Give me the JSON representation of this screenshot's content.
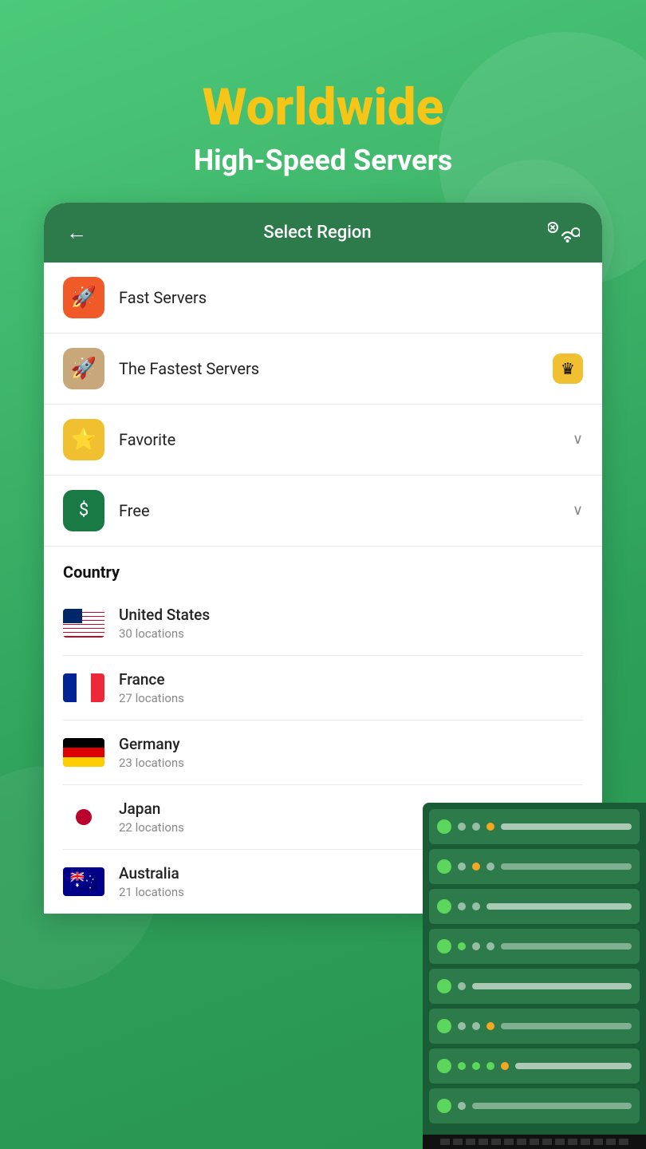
{
  "hero": {
    "title": "Worldwide",
    "subtitle": "High-Speed Servers"
  },
  "header": {
    "back_label": "←",
    "title": "Select Region"
  },
  "menu_items": [
    {
      "id": "fast-servers",
      "label": "Fast Servers",
      "icon_type": "orange",
      "icon": "🚀",
      "has_chevron": false,
      "has_crown": false
    },
    {
      "id": "fastest-servers",
      "label": "The Fastest Servers",
      "icon_type": "tan",
      "icon": "🚀",
      "has_chevron": false,
      "has_crown": true
    },
    {
      "id": "favorite",
      "label": "Favorite",
      "icon_type": "yellow",
      "icon": "⭐",
      "has_chevron": true,
      "has_crown": false
    },
    {
      "id": "free",
      "label": "Free",
      "icon_type": "green",
      "icon": "💲",
      "has_chevron": true,
      "has_crown": false
    }
  ],
  "country_section": {
    "header": "Country",
    "countries": [
      {
        "id": "us",
        "name": "United States",
        "locations": "30 locations",
        "flag": "us"
      },
      {
        "id": "fr",
        "name": "France",
        "locations": "27 locations",
        "flag": "fr"
      },
      {
        "id": "de",
        "name": "Germany",
        "locations": "23 locations",
        "flag": "de"
      },
      {
        "id": "jp",
        "name": "Japan",
        "locations": "22 locations",
        "flag": "jp"
      },
      {
        "id": "au",
        "name": "Australia",
        "locations": "21 locations",
        "flag": "au"
      }
    ]
  },
  "icons": {
    "back": "←",
    "chevron_down": "∨",
    "crown": "♛",
    "wifi_search": "📡"
  }
}
